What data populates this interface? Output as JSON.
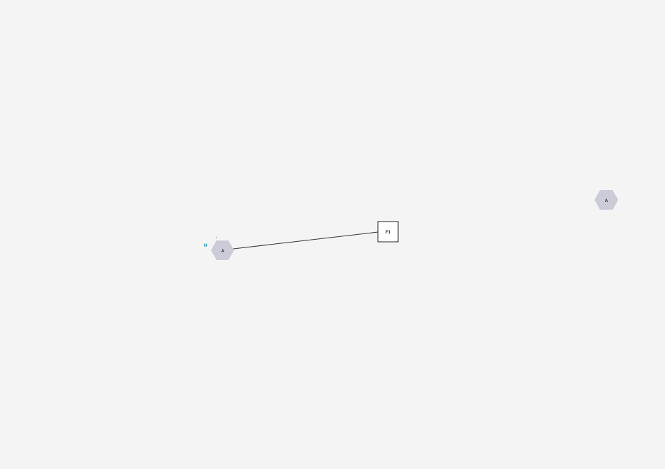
{
  "diagram": {
    "nodes": [
      {
        "id": "node-a-left",
        "shape": "hexagon",
        "label": "A",
        "fill": "#ccccd8"
      },
      {
        "id": "node-f1",
        "shape": "square",
        "label": "F1",
        "fill": "#ffffff",
        "stroke": "#222222"
      },
      {
        "id": "node-a-right",
        "shape": "hexagon",
        "label": "A",
        "fill": "#ccccd8"
      }
    ],
    "edges": [
      {
        "from": "node-a-left",
        "to": "node-f1",
        "color": "#333333"
      }
    ],
    "annotations": {
      "n_label": {
        "text": "N",
        "color": "#1a9bbf"
      },
      "i_label": {
        "text": "I",
        "color": "#888888"
      }
    }
  }
}
